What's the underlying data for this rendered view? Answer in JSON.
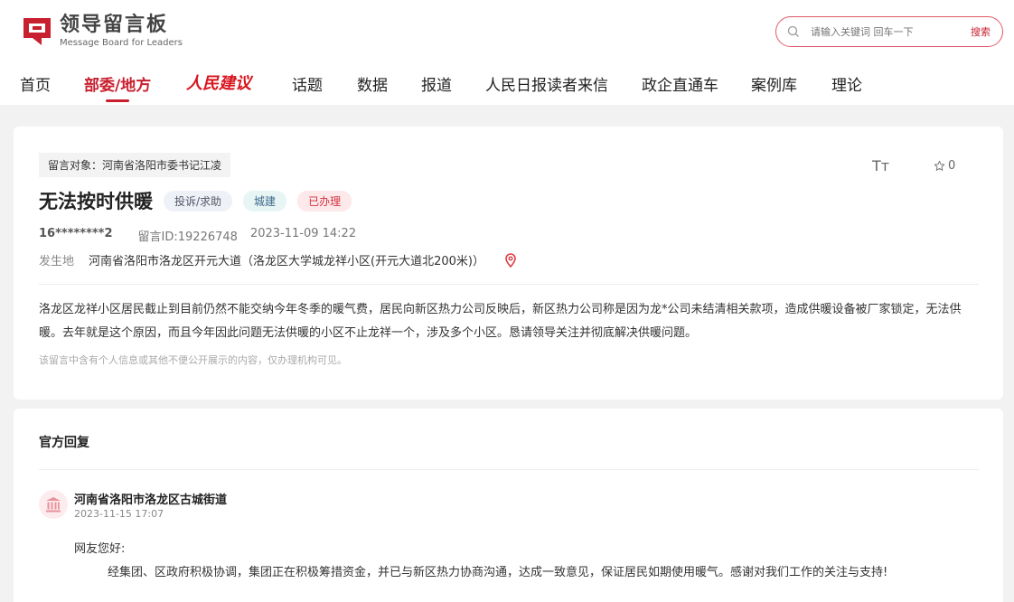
{
  "brand": {
    "name_cn": "领导留言板",
    "name_en": "Message Board for Leaders",
    "color": "#c8202f"
  },
  "search": {
    "placeholder": "请输入关键词 回车一下",
    "button_label": "搜索"
  },
  "nav": {
    "items": [
      {
        "label": "首页"
      },
      {
        "label": "部委/地方",
        "active": true
      },
      {
        "label": "人民建议"
      },
      {
        "label": "话题"
      },
      {
        "label": "数据"
      },
      {
        "label": "报道"
      },
      {
        "label": "人民日报读者来信"
      },
      {
        "label": "政企直通车"
      },
      {
        "label": "案例库"
      },
      {
        "label": "理论"
      }
    ]
  },
  "message": {
    "target": "留言对象：河南省洛阳市委书记江凌",
    "title": "无法按时供暖",
    "tags": [
      "投诉/求助",
      "城建",
      "已办理"
    ],
    "user": "16********2",
    "id_label": "留言ID:19226748",
    "time": "2023-11-09 14:22",
    "place_label": "发生地",
    "place_value": "河南省洛阳市洛龙区开元大道（洛龙区大学城龙祥小区(开元大道北200米)）",
    "star_count": "0",
    "font_tool": "Tт",
    "body_line1": "洛龙区龙祥小区居民截止到目前仍然不能交纳今年冬季的暖气费，居民向新区热力公司反映后，新区热力公司称是因为龙*公司未结清相关款项，造成供暖设备被厂家锁定，无法供",
    "body_line2": "暖。去年就是这个原因，而且今年因此问题无法供暖的小区不止龙祥一个，涉及多个小区。恳请领导关注并彻底解决供暖问题。",
    "privacy_note": "该留言中含有个人信息或其他不便公开展示的内容，仅办理机构可见。"
  },
  "reply": {
    "heading": "官方回复",
    "org": "河南省洛阳市洛龙区古城街道",
    "time": "2023-11-15 17:07",
    "greeting": "网友您好:",
    "text": "经集团、区政府积极协调，集团正在积极筹措资金，并已与新区热力协商沟通，达成一致意见，保证居民如期使用暖气。感谢对我们工作的关注与支持!"
  }
}
